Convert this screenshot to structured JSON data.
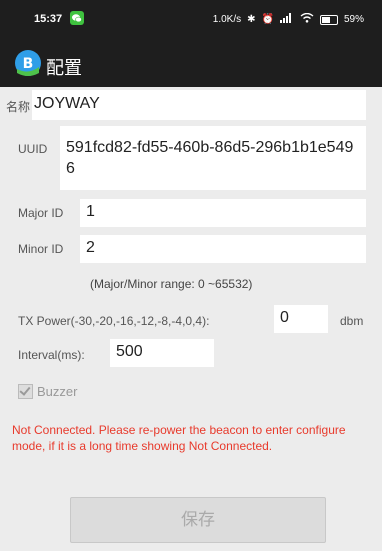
{
  "status_bar": {
    "time": "15:37",
    "network_speed": "1.0K/s",
    "battery": "59%"
  },
  "app_bar": {
    "title": "配置"
  },
  "form": {
    "name_label": "名称",
    "name_value": "JOYWAY",
    "uuid_label": "UUID",
    "uuid_value": "591fcd82-fd55-460b-86d5-296b1b1e5496",
    "major_label": "Major ID",
    "major_value": "1",
    "minor_label": "Minor ID",
    "minor_value": "2",
    "range_hint": "(Major/Minor range: 0 ~65532)",
    "tx_label": "TX Power(-30,-20,-16,-12,-8,-4,0,4):",
    "tx_value": "0",
    "tx_unit": "dbm",
    "interval_label": "Interval(ms):",
    "interval_value": "500",
    "buzzer_label": "Buzzer",
    "buzzer_checked": true
  },
  "status_message": "Not Connected. Please re-power the beacon to enter configure mode, if it is a long time showing Not Connected.",
  "save_label": "保存",
  "colors": {
    "bar_bg": "#1e1e1e",
    "page_bg": "#ececec",
    "error_text": "#e83a2c",
    "logo_blue": "#2f9ee8",
    "logo_green": "#4ec24b"
  }
}
